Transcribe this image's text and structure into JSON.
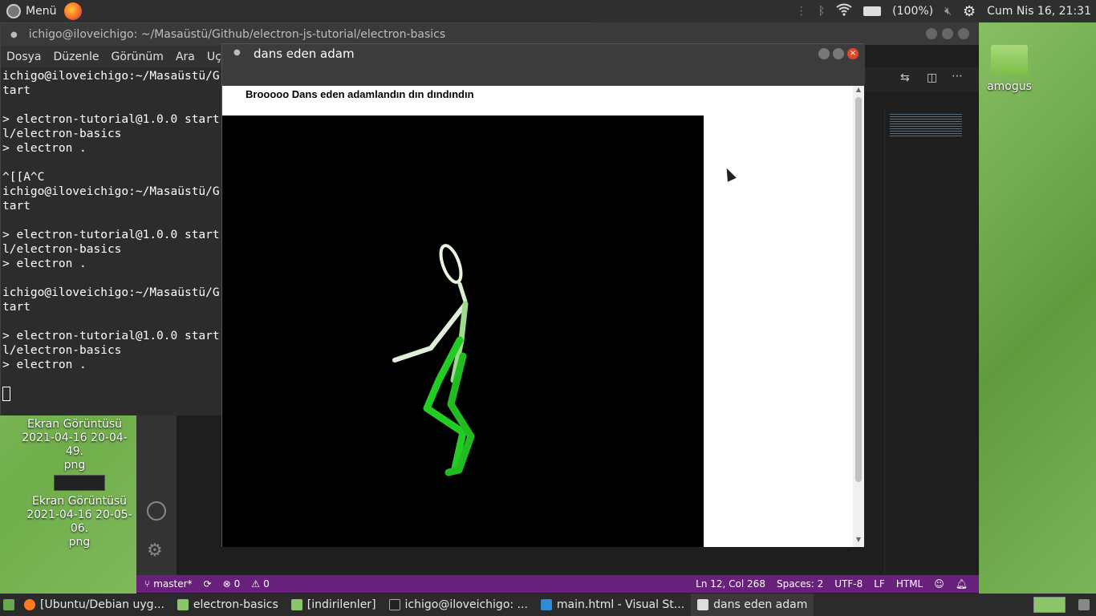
{
  "top_panel": {
    "menu_label": "Menü",
    "battery": "(100%)",
    "clock": "Cum Nis 16, 21:31"
  },
  "desktop": {
    "folder_label": "amogus",
    "file1": [
      "Ekran Görüntüsü",
      "2021-04-16 20-04-49.",
      "png"
    ],
    "file2": [
      "Ekran Görüntüsü",
      "2021-04-16 20-05-06.",
      "png"
    ]
  },
  "terminal": {
    "title": "ichigo@iloveichigo: ~/Masaüstü/Github/electron-js-tutorial/electron-basics",
    "menu": [
      "Dosya",
      "Düzenle",
      "Görünüm",
      "Ara",
      "Uçbiri"
    ],
    "lines": [
      "ichigo@iloveichigo:~/Masaüstü/G",
      "tart",
      "",
      "> electron-tutorial@1.0.0 start",
      "l/electron-basics",
      "> electron .",
      "",
      "^[[A^C",
      "ichigo@iloveichigo:~/Masaüstü/G",
      "tart",
      "",
      "> electron-tutorial@1.0.0 start",
      "l/electron-basics",
      "> electron .",
      "",
      "ichigo@iloveichigo:~/Masaüstü/G",
      "tart",
      "",
      "> electron-tutorial@1.0.0 start",
      "l/electron-basics",
      "> electron .",
      "",
      ""
    ]
  },
  "dance_window": {
    "title": "dans eden adam",
    "heading": "Brooooo Dans eden adamlandın dın dındındın"
  },
  "vscode": {
    "branch": "master*",
    "errors": "0",
    "warnings": "0",
    "cursor": "Ln 12, Col 268",
    "spaces": "Spaces: 2",
    "encoding": "UTF-8",
    "eol": "LF",
    "language": "HTML"
  },
  "taskbar": {
    "items": [
      "[Ubuntu/Debian uyg...",
      "electron-basics",
      "[indirilenler]",
      "ichigo@iloveichigo: ...",
      "main.html - Visual St...",
      "dans eden adam"
    ]
  },
  "colors": {
    "accent_purple": "#68217a",
    "close_red": "#e0462a",
    "stick_green": "#22cc22"
  }
}
